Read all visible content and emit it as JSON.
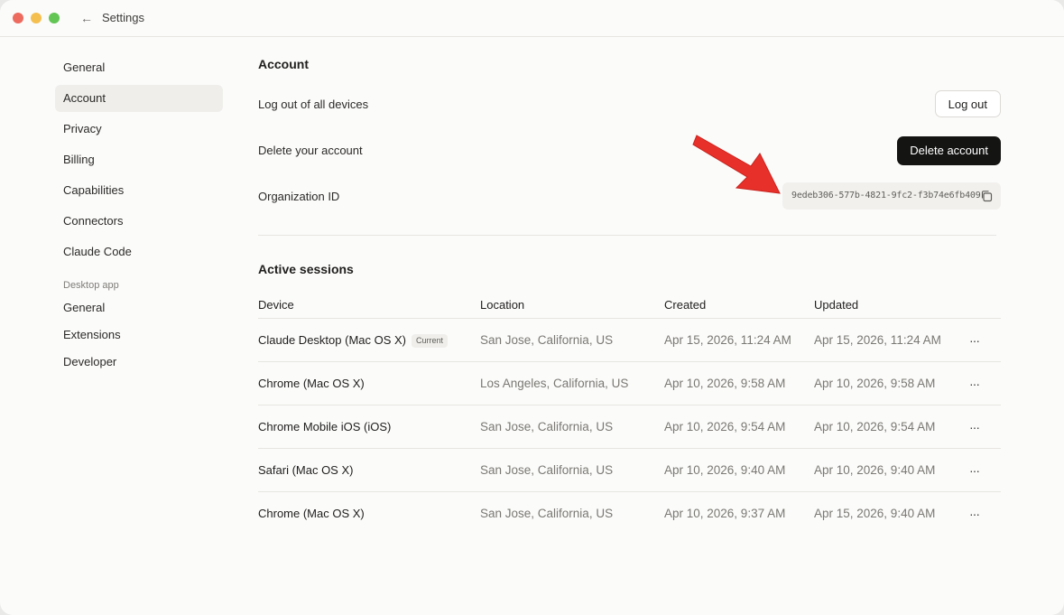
{
  "window": {
    "title": "Settings"
  },
  "sidebar": {
    "items": [
      {
        "label": "General"
      },
      {
        "label": "Account"
      },
      {
        "label": "Privacy"
      },
      {
        "label": "Billing"
      },
      {
        "label": "Capabilities"
      },
      {
        "label": "Connectors"
      },
      {
        "label": "Claude Code"
      }
    ],
    "section_label": "Desktop app",
    "desktop_items": [
      {
        "label": "General"
      },
      {
        "label": "Extensions"
      },
      {
        "label": "Developer"
      }
    ],
    "active": "Account"
  },
  "account": {
    "title": "Account",
    "logout_label": "Log out of all devices",
    "logout_button": "Log out",
    "delete_label": "Delete your account",
    "delete_button": "Delete account",
    "org_label": "Organization ID",
    "org_id": "9edeb306-577b-4821-9fc2-f3b74e6fb409"
  },
  "sessions": {
    "title": "Active sessions",
    "columns": [
      "Device",
      "Location",
      "Created",
      "Updated"
    ],
    "rows": [
      {
        "device": "Claude Desktop (Mac OS X)",
        "badge": "Current",
        "location": "San Jose, California, US",
        "created": "Apr 15, 2026, 11:24 AM",
        "updated": "Apr 15, 2026, 11:24 AM"
      },
      {
        "device": "Chrome (Mac OS X)",
        "badge": "",
        "location": "Los Angeles, California, US",
        "created": "Apr 10, 2026, 9:58 AM",
        "updated": "Apr 10, 2026, 9:58 AM"
      },
      {
        "device": "Chrome Mobile iOS (iOS)",
        "badge": "",
        "location": "San Jose, California, US",
        "created": "Apr 10, 2026, 9:54 AM",
        "updated": "Apr 10, 2026, 9:54 AM"
      },
      {
        "device": "Safari (Mac OS X)",
        "badge": "",
        "location": "San Jose, California, US",
        "created": "Apr 10, 2026, 9:40 AM",
        "updated": "Apr 10, 2026, 9:40 AM"
      },
      {
        "device": "Chrome (Mac OS X)",
        "badge": "",
        "location": "San Jose, California, US",
        "created": "Apr 10, 2026, 9:37 AM",
        "updated": "Apr 15, 2026, 9:40 AM"
      }
    ],
    "more_glyph": "···"
  },
  "icons": {
    "back": "back-arrow-icon",
    "copy": "copy-icon",
    "more": "more-horizontal-icon",
    "annotation": "red-arrow-annotation"
  },
  "colors": {
    "accent_dark": "#141413",
    "annotation_red": "#e8302a",
    "traffic_red": "#ed6a5e",
    "traffic_yellow": "#f5bf4f",
    "traffic_green": "#62c554"
  }
}
